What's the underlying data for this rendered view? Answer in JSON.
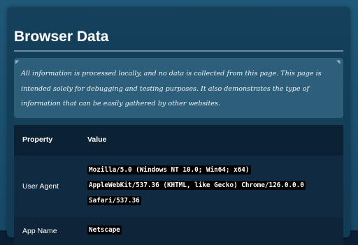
{
  "title": "Browser Data",
  "notice": "All information is processed locally, and no data is collected from this page. This page is intended solely for debugging and testing purposes. It also demonstrates the type of information that can be easily gathered by other websites.",
  "table": {
    "headers": {
      "property": "Property",
      "value": "Value"
    },
    "rows": [
      {
        "property": "User Agent",
        "value_lines": [
          "Mozilla/5.0 (Windows NT 10.0; Win64; x64)",
          "AppleWebKit/537.36 (KHTML, like Gecko) Chrome/126.0.0.0",
          "Safari/537.36"
        ]
      },
      {
        "property": "App Name",
        "value": "Netscape"
      }
    ]
  },
  "colors": {
    "background": "#1f5878",
    "card": "#14405c",
    "notice": "#2d5f7a",
    "table_header": "#0b2235",
    "code_bg": "#000000"
  }
}
